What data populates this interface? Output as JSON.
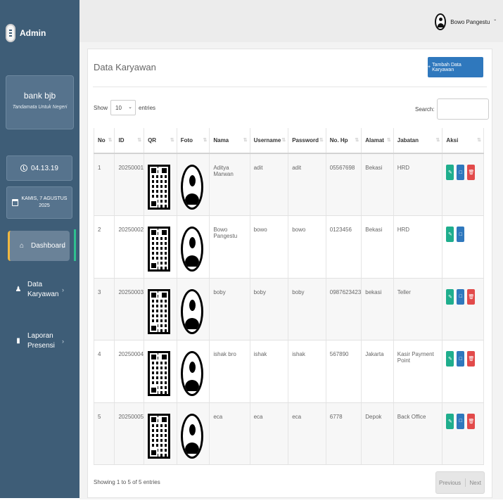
{
  "sidebar": {
    "brand": "Admin",
    "bank_name": "bank bjb",
    "tagline": "Tandamata Untuk Negeri",
    "time": "04.13.19",
    "date_line1": "KAMIS, 7 AGUSTUS",
    "date_line2": "2025",
    "menu": {
      "dashboard": "Dashboard",
      "data_line1": "Data",
      "data_line2": "Karyawan",
      "laporan_line1": "Laporan",
      "laporan_line2": "Presensi"
    }
  },
  "topbar": {
    "user_name": "Bowo Pangestu"
  },
  "main": {
    "title": "Data Karyawan",
    "add_button": "Tambah Data Karyawan",
    "show_label": "Show",
    "entries_value": "10",
    "entries_label": "entries",
    "search_label": "Search:",
    "columns": [
      "No",
      "ID",
      "QR",
      "Foto",
      "Nama",
      "Username",
      "Password",
      "No. Hp",
      "Alamat",
      "Jabatan",
      "Aksi"
    ],
    "rows": [
      {
        "no": "1",
        "id": "20250001",
        "nama": "Aditya Marwan",
        "username": "adit",
        "password": "adit",
        "hp": "05567698",
        "alamat": "Bekasi",
        "jabatan": "HRD"
      },
      {
        "no": "2",
        "id": "20250002",
        "nama": "Bowo Pangestu",
        "username": "bowo",
        "password": "bowo",
        "hp": "0123456",
        "alamat": "Bekasi",
        "jabatan": "HRD"
      },
      {
        "no": "3",
        "id": "20250003",
        "nama": "boby",
        "username": "boby",
        "password": "boby",
        "hp": "0987623423",
        "alamat": "bekasi",
        "jabatan": "Teller"
      },
      {
        "no": "4",
        "id": "20250004",
        "nama": "ishak bro",
        "username": "ishak",
        "password": "ishak",
        "hp": "567890",
        "alamat": "Jakarta",
        "jabatan": "Kasir Payment Point"
      },
      {
        "no": "5",
        "id": "20250005",
        "nama": "eca",
        "username": "eca",
        "password": "eca",
        "hp": "6778",
        "alamat": "Depok",
        "jabatan": "Back Office"
      }
    ],
    "showing_text": "Showing 1 to 5 of 5 entries",
    "prev_label": "Previous",
    "next_label": "Next"
  },
  "colors": {
    "sidebar": "#3e5d77",
    "primary": "#2f78bd",
    "edit": "#1fae8d",
    "delete": "#e24a4a"
  }
}
